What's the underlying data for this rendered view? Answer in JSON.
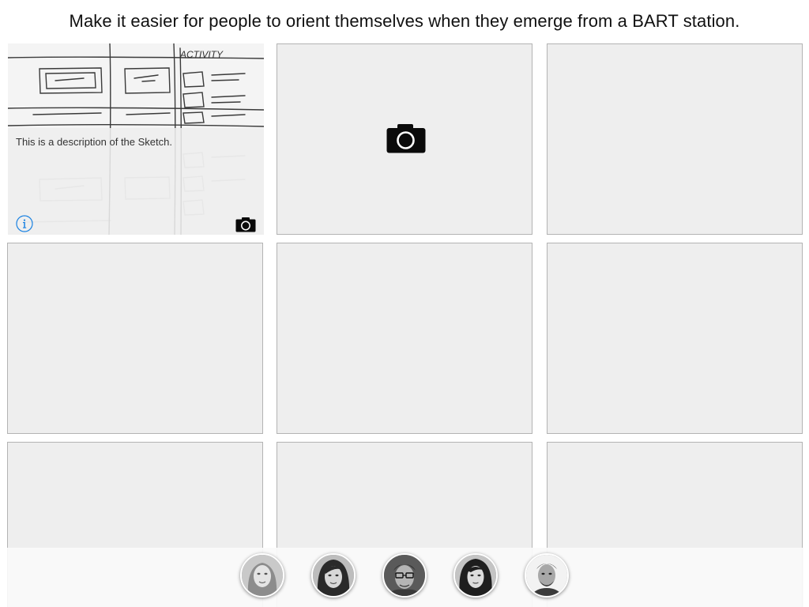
{
  "header": {
    "prompt": "Make it easier for people to orient themselves when they emerge from a BART station."
  },
  "sketch_tile": {
    "sketch_word": "ACTIVITY",
    "description": "This is a description of the Sketch.",
    "info_icon": "info-icon",
    "camera_icon": "camera-icon"
  },
  "empty_tiles": {
    "camera_icon": "camera-icon"
  },
  "team": {
    "members": [
      {
        "name": "",
        "icon": "avatar-photo"
      },
      {
        "name": "",
        "icon": "avatar-photo"
      },
      {
        "name": "",
        "icon": "avatar-photo"
      },
      {
        "name": "",
        "icon": "avatar-photo"
      },
      {
        "name": "",
        "icon": "avatar-photo"
      }
    ]
  },
  "colors": {
    "accent": "#1a82e2",
    "tile_background": "#eeeeee",
    "tile_border": "#b3b3b3"
  }
}
